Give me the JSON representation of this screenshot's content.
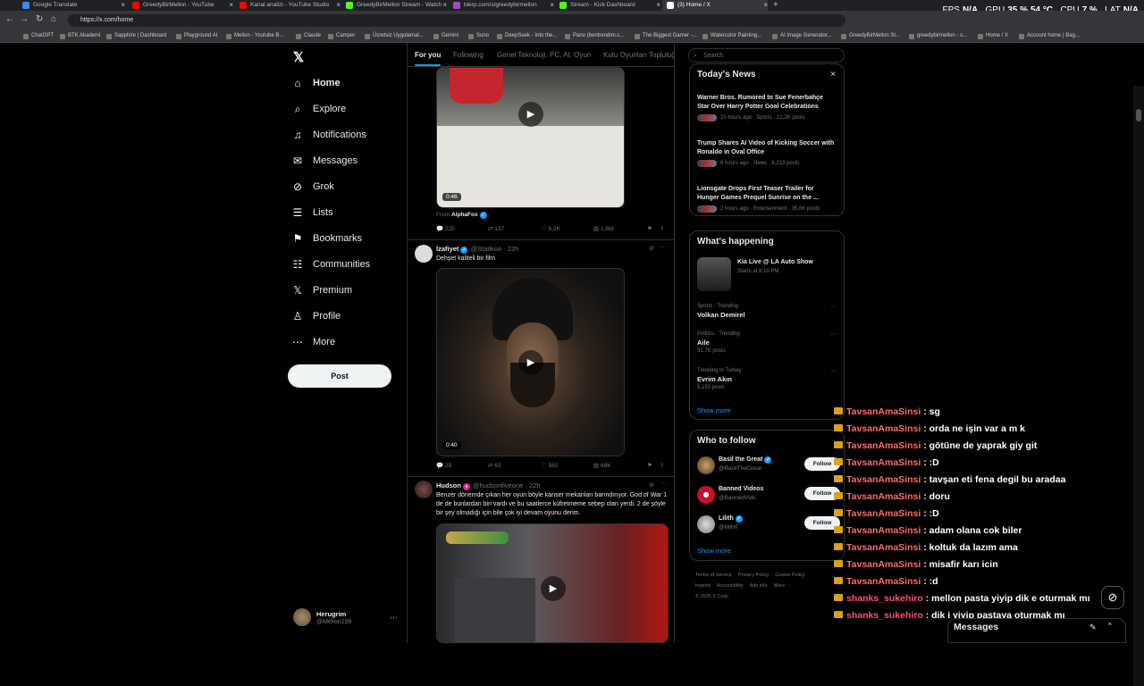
{
  "browser": {
    "tabs": [
      {
        "title": "Google Translate",
        "color": "#4285f4"
      },
      {
        "title": "GreedyBirMellon - YouTube",
        "color": "#ff0000"
      },
      {
        "title": "Kanal analizi - YouTube Studio",
        "color": "#ff0000"
      },
      {
        "title": "GreedyBirMellon Stream - Watch",
        "color": "#53fc18"
      },
      {
        "title": "blerp.com/s/greedybirmellon",
        "color": "#9b4dca"
      },
      {
        "title": "Stream - Kick Dashboard",
        "color": "#53fc18"
      },
      {
        "title": "(3) Home / X",
        "color": "#ffffff"
      }
    ],
    "url": "https://x.com/home",
    "bookmarks": [
      "ChatGPT",
      "BTK Akademi",
      "Sapphire | Dashboard",
      "Playground AI",
      "Mellon - Youtube B...",
      "Claude",
      "Camper",
      "Ücretsiz Uygulamal...",
      "Gemini",
      "Suno",
      "DeepSeek - Into the...",
      "Pano (bentrendim.c...",
      "The Biggest Gamer -...",
      "Watercolor Painting...",
      "AI Image Generator...",
      "GreedyBirMellon St...",
      "greedybirmellon - s...",
      "Home / X",
      "Account home | Bag..."
    ],
    "stats": {
      "fps_label": "FPS",
      "fps": "N/A",
      "gpu_label": "GPU",
      "gpu_pct": "35 %",
      "gpu_temp": "54 °C",
      "cpu_label": "CPU",
      "cpu_pct": "7 %",
      "lat_label": "LAT",
      "lat": "N/A"
    }
  },
  "nav": {
    "logo": "𝕏",
    "items": [
      {
        "label": "Home",
        "icon": "⌂"
      },
      {
        "label": "Explore",
        "icon": "⌕"
      },
      {
        "label": "Notifications",
        "icon": "♫"
      },
      {
        "label": "Messages",
        "icon": "✉"
      },
      {
        "label": "Grok",
        "icon": "⊘"
      },
      {
        "label": "Lists",
        "icon": "☰"
      },
      {
        "label": "Bookmarks",
        "icon": "⚑"
      },
      {
        "label": "Communities",
        "icon": "☷"
      },
      {
        "label": "Premium",
        "icon": "𝕏"
      },
      {
        "label": "Profile",
        "icon": "♙"
      },
      {
        "label": "More",
        "icon": "⋯"
      }
    ],
    "post_label": "Post",
    "account": {
      "name": "Herugrim",
      "handle": "@Mellon199"
    }
  },
  "feed": {
    "tabs": [
      "For you",
      "Following",
      "Genel Teknoloji, PC, AI, Oyun",
      "Kutu Oyunları Topluluğu"
    ],
    "post1": {
      "duration": "0:46",
      "from_label": "From",
      "from": "AlphaFox",
      "replies": "225",
      "reposts": "137",
      "likes": "5,2K",
      "views": "1,6M"
    },
    "post2": {
      "name": "İzafiyet",
      "handle": "@Statikoo · 22h",
      "text": "Dehşet kaliteli bir film",
      "duration": "0:40",
      "replies": "29",
      "reposts": "63",
      "likes": "982",
      "views": "68K"
    },
    "post3": {
      "name": "Hudson",
      "handle": "@hudsonfiveone · 22h",
      "text": "Benzer dönemde çıkan her oyun böyle kanser mekanları barındırıyor. God of War 1 de de bunlardan biri vardı ve bu saatlerce küfretmeme sebep olan yerdi. 2 de şöyle bir şey olmadığı için bile çok iyi devam oyunu derim."
    }
  },
  "sidebar": {
    "search_placeholder": "Search",
    "news_title": "Today's News",
    "news": [
      {
        "headline": "Warner Bros. Rumored to Sue Fenerbahçe Star Over Harry Potter Goal Celebrations",
        "meta": "10 hours ago · Sports · 12,2K posts"
      },
      {
        "headline": "Trump Shares AI Video of Kicking Soccer with Ronaldo in Oval Office",
        "meta": "6 hours ago · News · 8,213 posts"
      },
      {
        "headline": "Lionsgate Drops First Teaser Trailer for Hunger Games Prequel Sunrise on the ...",
        "meta": "2 hours ago · Entertainment · 35,6K posts"
      }
    ],
    "happening_title": "What's happening",
    "live": {
      "title": "Kia Live @ LA Auto Show",
      "sub": "Starts at 8:10 PM"
    },
    "trends": [
      {
        "cat": "Sports · Trending",
        "title": "Volkan Demirel",
        "count": ""
      },
      {
        "cat": "Politics · Trending",
        "title": "Aile",
        "count": "31,7K posts"
      },
      {
        "cat": "Trending in Turkey",
        "title": "Evrim Akın",
        "count": "5,193 posts"
      }
    ],
    "show_more": "Show more",
    "wtf_title": "Who to follow",
    "follow": [
      {
        "name": "Basil the Great",
        "handle": "@BasilTheGreat",
        "verified": true
      },
      {
        "name": "Banned Videos",
        "handle": "@BannedVids",
        "verified": false
      },
      {
        "name": "Lilith",
        "handle": "@lilith0",
        "verified": true
      }
    ],
    "follow_label": "Follow",
    "footer": [
      "Terms of Service",
      "Privacy Policy",
      "Cookie Policy",
      "Imprint",
      "Accessibility",
      "Ads info",
      "More ···",
      "© 2025 X Corp."
    ]
  },
  "chat": [
    {
      "user": "TavsanAmaSinsi",
      "msg": ": sg"
    },
    {
      "user": "TavsanAmaSinsi",
      "msg": ": orda ne işin var a m k"
    },
    {
      "user": "TavsanAmaSinsi",
      "msg": ": götüne de yaprak giy git"
    },
    {
      "user": "TavsanAmaSinsi",
      "msg": ": :D"
    },
    {
      "user": "TavsanAmaSinsi",
      "msg": ": tavşan eti fena degil bu aradaa"
    },
    {
      "user": "TavsanAmaSinsi",
      "msg": ": doru"
    },
    {
      "user": "TavsanAmaSinsi",
      "msg": ": :D"
    },
    {
      "user": "TavsanAmaSinsi",
      "msg": ": adam olana cok biler"
    },
    {
      "user": "TavsanAmaSinsi",
      "msg": ": koltuk da lazım ama"
    },
    {
      "user": "TavsanAmaSinsi",
      "msg": ": misafir karı icin"
    },
    {
      "user": "TavsanAmaSinsi",
      "msg": ": :d"
    },
    {
      "user": "shanks_sukehiro",
      "msg": ": mellon pasta yiyip dik e oturmak mı"
    },
    {
      "user": "shanks_sukehiro",
      "msg": ": dik i yiyip pastaya oturmak mı"
    }
  ],
  "messages_drawer": {
    "title": "Messages"
  }
}
